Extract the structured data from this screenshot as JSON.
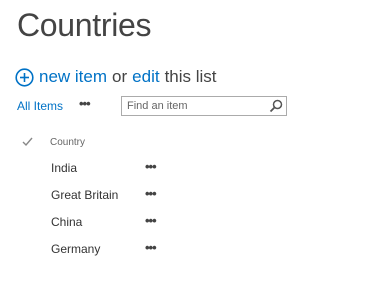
{
  "page": {
    "title": "Countries"
  },
  "command_bar": {
    "new_item_label": "new item",
    "or_text": "or",
    "edit_label": "edit",
    "this_list_text": "this list",
    "plus_icon": "plus-circle-icon"
  },
  "views": {
    "current_view": "All Items",
    "more_views": "•••"
  },
  "search": {
    "placeholder": "Find an item",
    "value": "",
    "icon": "search-icon"
  },
  "list": {
    "select_all_icon": "checkmark-icon",
    "column_header": "Country",
    "row_menu": "•••",
    "rows": [
      {
        "title": "India"
      },
      {
        "title": "Great Britain"
      },
      {
        "title": "China"
      },
      {
        "title": "Germany"
      }
    ]
  },
  "colors": {
    "link": "#0072c6",
    "title": "#444444",
    "text": "#333333",
    "border": "#ababab"
  }
}
